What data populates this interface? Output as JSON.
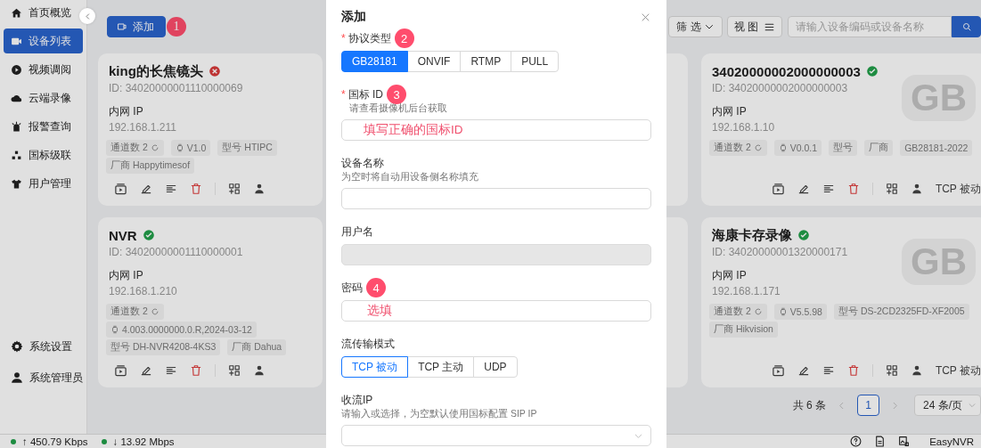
{
  "sidebar": {
    "items": [
      {
        "label": "首页概览",
        "selected": false
      },
      {
        "label": "设备列表",
        "selected": true
      },
      {
        "label": "视频调阅",
        "selected": false
      },
      {
        "label": "云端录像",
        "selected": false
      },
      {
        "label": "报警查询",
        "selected": false
      },
      {
        "label": "国标级联",
        "selected": false
      },
      {
        "label": "用户管理",
        "selected": false
      }
    ],
    "bottom_items": [
      {
        "label": "系统设置"
      },
      {
        "label": "系统管理员"
      }
    ]
  },
  "toolbar": {
    "add_button": "添加",
    "add_badge": "1",
    "filter_button": "筛 选",
    "view_button": "视 图",
    "search": {
      "placeholder": "请输入设备编码或设备名称"
    }
  },
  "cards": [
    {
      "kind": "full",
      "title": "king的长焦镜头",
      "online": false,
      "id": "ID: 34020000001110000069",
      "ip_label": "内网 IP",
      "ip": "192.168.1.211",
      "tags": [
        {
          "kind": "channels",
          "text": "通道数 2"
        },
        {
          "kind": "version",
          "text": "V1.0"
        },
        {
          "kind": "plain",
          "text": "型号 HTIPC"
        },
        {
          "kind": "plain",
          "text": "厂商 Happytimesof"
        }
      ]
    },
    {
      "kind": "covered"
    },
    {
      "kind": "full",
      "title": "34020000002000000003",
      "online": true,
      "id": "ID: 34020000002000000003",
      "ip_label": "内网 IP",
      "ip": "192.168.1.10",
      "logo": "GB",
      "tags": [
        {
          "kind": "channels",
          "text": "通道数 2"
        },
        {
          "kind": "version",
          "text": "V0.0.1"
        },
        {
          "kind": "plain",
          "text": "型号"
        },
        {
          "kind": "plain",
          "text": "厂商"
        },
        {
          "kind": "plain",
          "text": "GB28181-2022"
        }
      ],
      "transport": "TCP 被动"
    },
    {
      "kind": "full",
      "title": "NVR",
      "online": true,
      "id": "ID: 34020000001110000001",
      "ip_label": "内网 IP",
      "ip": "192.168.1.210",
      "tags": [
        {
          "kind": "channels",
          "text": "通道数 2"
        },
        {
          "kind": "version",
          "text": "4.003.0000000.0.R,2024-03-12"
        },
        {
          "kind": "plain",
          "text": "型号 DH-NVR4208-4KS3"
        },
        {
          "kind": "plain",
          "text": "厂商 Dahua"
        }
      ]
    },
    {
      "kind": "covered"
    },
    {
      "kind": "full",
      "title": "海康卡存录像",
      "online": true,
      "id": "ID: 34020000001320000171",
      "ip_label": "内网 IP",
      "ip": "192.168.1.171",
      "logo": "GB",
      "tags": [
        {
          "kind": "channels",
          "text": "通道数 2"
        },
        {
          "kind": "version",
          "text": "V5.5.98"
        },
        {
          "kind": "plain",
          "text": "型号 DS-2CD2325FD-XF2005"
        },
        {
          "kind": "plain",
          "text": "厂商 Hikvision"
        }
      ],
      "transport": "TCP 被动"
    }
  ],
  "pager": {
    "total": "共 6 条",
    "pages": [
      {
        "label": "1",
        "selected": true
      }
    ],
    "page_size": "24 条/页"
  },
  "status_bar": {
    "upload": "↑ 450.79 Kbps",
    "download": "↓ 13.92 Mbps",
    "brand": "EasyNVR"
  },
  "dialog": {
    "title": "添加",
    "fields": [
      {
        "kind": "segmented",
        "label": "协议类型",
        "required_mark": "*",
        "badge": "2",
        "options": [
          {
            "label": "GB28181",
            "selected": true
          },
          {
            "label": "ONVIF",
            "selected": false
          },
          {
            "label": "RTMP",
            "selected": false
          },
          {
            "label": "PULL",
            "selected": false
          }
        ]
      },
      {
        "kind": "input",
        "label": "国标 ID",
        "required_mark": "*",
        "badge": "3",
        "hint": "请查看摄像机后台获取",
        "note": "填写正确的国标ID",
        "disabled": false
      },
      {
        "kind": "input",
        "label": "设备名称",
        "hint": "为空时将自动用设备侧名称填充",
        "disabled": false
      },
      {
        "kind": "input",
        "label": "用户名",
        "disabled": true
      },
      {
        "kind": "input",
        "label": "密码",
        "badge": "4",
        "note": "选填",
        "disabled": false
      },
      {
        "kind": "segmented",
        "label": "流传输模式",
        "options": [
          {
            "label": "TCP 被动",
            "selected": true
          },
          {
            "label": "TCP 主动",
            "selected": false
          },
          {
            "label": "UDP",
            "selected": false
          }
        ]
      },
      {
        "kind": "select",
        "label": "收流IP",
        "hint": "请输入或选择，为空默认使用国标配置 SIP IP"
      }
    ]
  }
}
